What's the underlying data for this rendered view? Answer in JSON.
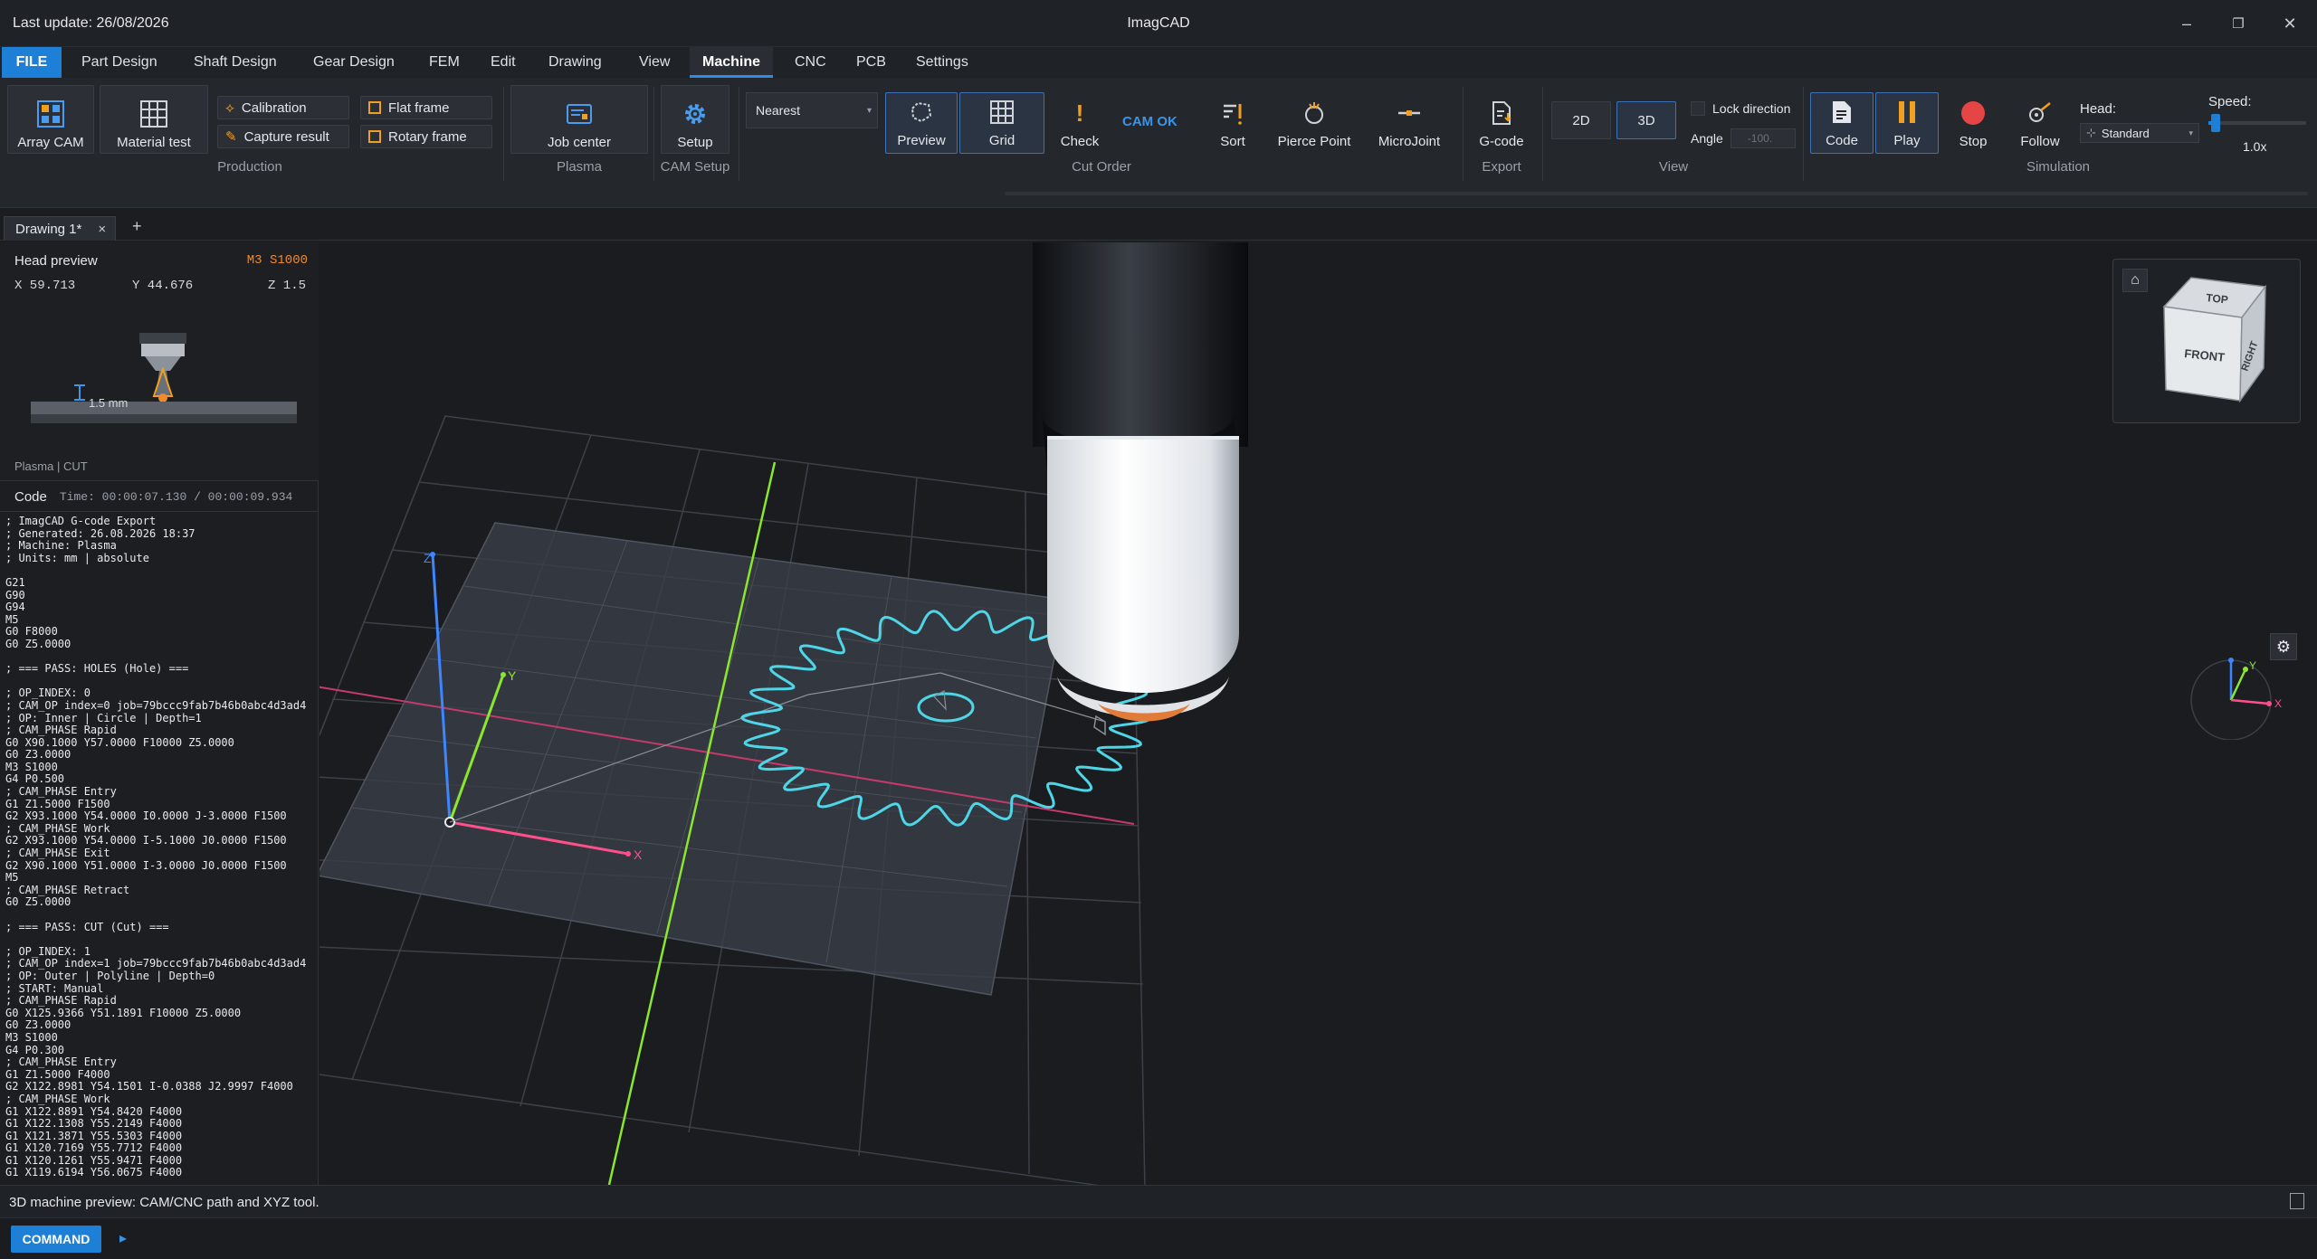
{
  "titlebar": {
    "last_update": "Last update: 26/08/2026",
    "app_title": "ImagCAD",
    "minimize": "–",
    "restore": "❐",
    "close": "✕"
  },
  "menu": {
    "file": "FILE",
    "items": [
      "Part Design",
      "Shaft Design",
      "Gear Design",
      "FEM",
      "Edit",
      "Drawing",
      "View",
      "Machine",
      "CNC",
      "PCB",
      "Settings"
    ],
    "active": "Machine"
  },
  "ribbon": {
    "production": {
      "array_cam": "Array CAM",
      "material_test": "Material test",
      "calibration": "Calibration",
      "capture_result": "Capture result",
      "flat_frame": "Flat frame",
      "rotary_frame": "Rotary frame",
      "label": "Production"
    },
    "plasma": {
      "job_center": "Job center",
      "label": "Plasma"
    },
    "cam_setup": {
      "setup": "Setup",
      "label": "CAM Setup"
    },
    "cut_order": {
      "nearest_value": "Nearest",
      "preview": "Preview",
      "grid": "Grid",
      "check": "Check",
      "cam_ok": "CAM OK",
      "sort": "Sort",
      "pierce_point": "Pierce Point",
      "microjoint": "MicroJoint",
      "label": "Cut Order"
    },
    "export": {
      "gcode": "G-code",
      "label": "Export"
    },
    "view": {
      "btn_2d": "2D",
      "btn_3d": "3D",
      "lock_direction": "Lock direction",
      "angle": "Angle",
      "angle_value": "-100.",
      "label": "View"
    },
    "simulation": {
      "code": "Code",
      "play": "Play",
      "stop": "Stop",
      "follow": "Follow",
      "head_label": "Head:",
      "head_value": "Standard",
      "speed_label": "Speed:",
      "speed_value": "1.0x",
      "speed_fraction": 0.05,
      "label": "Simulation"
    }
  },
  "tabs": {
    "doc_tab": "Drawing 1*",
    "close": "×",
    "add": "+"
  },
  "head_preview": {
    "title": "Head preview",
    "mcode": "M3 S1000",
    "x": "X 59.713",
    "y": "Y 44.676",
    "z": "Z 1.5",
    "gap": "1.5 mm",
    "footer": "Plasma | CUT"
  },
  "code_panel": {
    "title": "Code",
    "time": "Time: 00:00:07.130 / 00:00:09.934",
    "lines": [
      "; ImagCAD G-code Export",
      "; Generated: 26.08.2026 18:37",
      "; Machine: Plasma",
      "; Units: mm | absolute",
      "",
      "G21",
      "G90",
      "G94",
      "M5",
      "G0 F8000",
      "G0 Z5.0000",
      "",
      "; === PASS: HOLES (Hole) ===",
      "",
      "; OP_INDEX: 0",
      "; CAM_OP index=0 job=79bccc9fab7b46b0abc4d3ad4",
      "; OP: Inner | Circle | Depth=1",
      "; CAM_PHASE Rapid",
      "G0 X90.1000 Y57.0000 F10000 Z5.0000",
      "G0 Z3.0000",
      "M3 S1000",
      "G4 P0.500",
      "; CAM_PHASE Entry",
      "G1 Z1.5000 F1500",
      "G2 X93.1000 Y54.0000 I0.0000 J-3.0000 F1500",
      "; CAM_PHASE Work",
      "G2 X93.1000 Y54.0000 I-5.1000 J0.0000 F1500",
      "; CAM_PHASE Exit",
      "G2 X90.1000 Y51.0000 I-3.0000 J0.0000 F1500",
      "M5",
      "; CAM_PHASE Retract",
      "G0 Z5.0000",
      "",
      "; === PASS: CUT (Cut) ===",
      "",
      "; OP_INDEX: 1",
      "; CAM_OP index=1 job=79bccc9fab7b46b0abc4d3ad4",
      "; OP: Outer | Polyline | Depth=0",
      "; START: Manual",
      "; CAM_PHASE Rapid",
      "G0 X125.9366 Y51.1891 F10000 Z5.0000",
      "G0 Z3.0000",
      "M3 S1000",
      "G4 P0.300",
      "; CAM_PHASE Entry",
      "G1 Z1.5000 F4000",
      "G2 X122.8981 Y54.1501 I-0.0388 J2.9997 F4000",
      "; CAM_PHASE Work",
      "G1 X122.8891 Y54.8420 F4000",
      "G1 X122.1308 Y55.2149 F4000",
      "G1 X121.3871 Y55.5303 F4000",
      "G1 X120.7169 Y55.7712 F4000",
      "G1 X120.1261 Y55.9471 F4000",
      "G1 X119.6194 Y56.0675 F4000"
    ]
  },
  "viewport": {
    "axis_x": "X",
    "axis_y": "Y",
    "axis_z": "Z"
  },
  "viewcube": {
    "top": "TOP",
    "front": "FRONT",
    "right": "RIGHT"
  },
  "status": {
    "message": "3D machine preview: CAM/CNC path and XYZ tool.",
    "command": "COMMAND",
    "prompt": "▸"
  },
  "colors": {
    "accent": "#1e7fd6",
    "cam_ok": "#3a94e8",
    "gear_path": "#4fd6e6",
    "axis_x": "#ff4f8b",
    "axis_y": "#8ae62e",
    "axis_z": "#3d86ff",
    "torch_tip": "#e07b39",
    "stop_red": "#e64545",
    "play_orange": "#f0a020"
  }
}
